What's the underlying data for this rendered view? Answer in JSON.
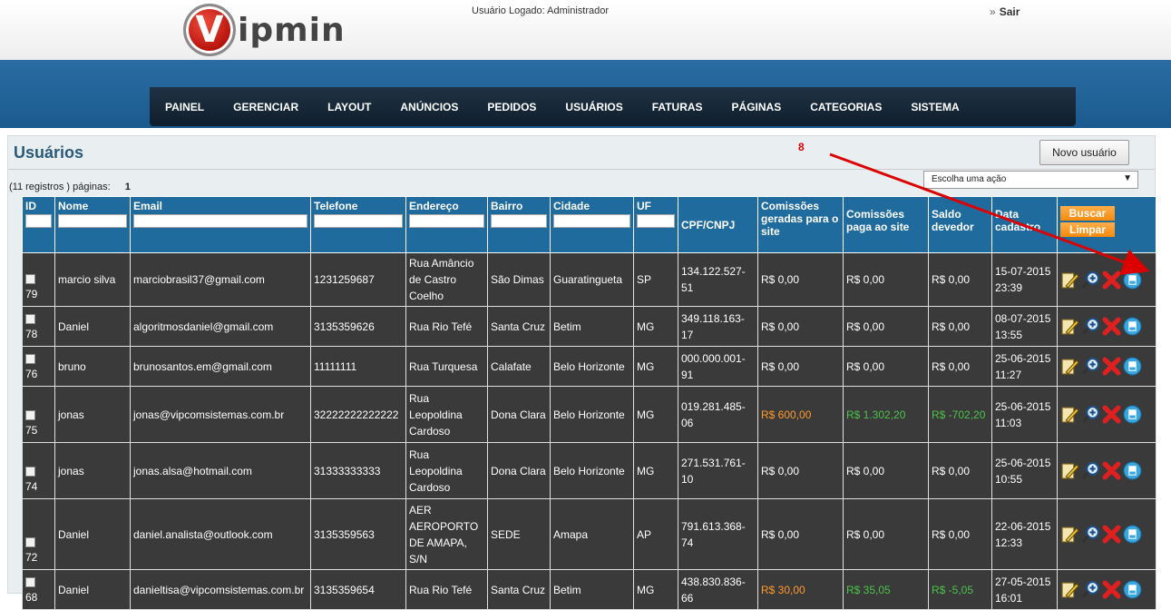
{
  "app": {
    "logo_letter": "V",
    "logo_text": "ipmin",
    "logged_user": "Usuário Logado: Administrador",
    "logout_label": "Sair"
  },
  "nav": [
    "PAINEL",
    "GERENCIAR",
    "LAYOUT",
    "ANÚNCIOS",
    "PEDIDOS",
    "USUÁRIOS",
    "FATURAS",
    "PÁGINAS",
    "CATEGORIAS",
    "SISTEMA"
  ],
  "page": {
    "title": "Usuários",
    "new_button": "Novo usuário",
    "marker": "8",
    "pager_text": "(11 registros ) páginas:",
    "pager_page": "1",
    "action_select": "Escolha uma ação"
  },
  "table": {
    "headers": {
      "id": "ID",
      "nome": "Nome",
      "email": "Email",
      "telefone": "Telefone",
      "endereco": "Endereço",
      "bairro": "Bairro",
      "cidade": "Cidade",
      "uf": "UF",
      "cpf": "CPF/CNPJ",
      "comissoes_geradas": "Comissões geradas para o site",
      "comissoes_paga": "Comissões paga ao site",
      "saldo": "Saldo devedor",
      "data": "Data cadastro"
    },
    "search_button": "Buscar",
    "clear_button": "Limpar",
    "rows": [
      {
        "id": "79",
        "nome": "marcio silva",
        "email": "marciobrasil37@gmail.com",
        "telefone": "1231259687",
        "endereco": "Rua Amâncio de Castro Coelho",
        "bairro": "São Dimas",
        "cidade": "Guaratingueta",
        "uf": "SP",
        "cpf": "134.122.527-51",
        "geradas": "R$ 0,00",
        "paga": "R$ 0,00",
        "saldo": "R$ 0,00",
        "data": "15-07-2015 23:39"
      },
      {
        "id": "78",
        "nome": "Daniel",
        "email": "algoritmosdaniel@gmail.com",
        "telefone": "3135359626",
        "endereco": "Rua Rio Tefé",
        "bairro": "Santa Cruz",
        "cidade": "Betim",
        "uf": "MG",
        "cpf": "349.118.163-17",
        "geradas": "R$ 0,00",
        "paga": "R$ 0,00",
        "saldo": "R$ 0,00",
        "data": "08-07-2015 13:55"
      },
      {
        "id": "76",
        "nome": "bruno",
        "email": "brunosantos.em@gmail.com",
        "telefone": "11111111",
        "endereco": "Rua Turquesa",
        "bairro": "Calafate",
        "cidade": "Belo Horizonte",
        "uf": "MG",
        "cpf": "000.000.001-91",
        "geradas": "R$ 0,00",
        "paga": "R$ 0,00",
        "saldo": "R$ 0,00",
        "data": "25-06-2015 11:27"
      },
      {
        "id": "75",
        "nome": "jonas",
        "email": "jonas@vipcomsistemas.com.br",
        "telefone": "32222222222222",
        "endereco": "Rua Leopoldina Cardoso",
        "bairro": "Dona Clara",
        "cidade": "Belo Horizonte",
        "uf": "MG",
        "cpf": "019.281.485-06",
        "geradas": "R$ 600,00",
        "paga": "R$ 1.302,20",
        "saldo": "R$ -702,20",
        "data": "25-06-2015 11:03"
      },
      {
        "id": "74",
        "nome": "jonas",
        "email": "jonas.alsa@hotmail.com",
        "telefone": "31333333333",
        "endereco": "Rua Leopoldina Cardoso",
        "bairro": "Dona Clara",
        "cidade": "Belo Horizonte",
        "uf": "MG",
        "cpf": "271.531.761-10",
        "geradas": "R$ 0,00",
        "paga": "R$ 0,00",
        "saldo": "R$ 0,00",
        "data": "25-06-2015 10:55"
      },
      {
        "id": "72",
        "nome": "Daniel",
        "email": "daniel.analista@outlook.com",
        "telefone": "3135359563",
        "endereco": "AER AEROPORTO DE AMAPA, S/N",
        "bairro": "SEDE",
        "cidade": "Amapa",
        "uf": "AP",
        "cpf": "791.613.368-74",
        "geradas": "R$ 0,00",
        "paga": "R$ 0,00",
        "saldo": "R$ 0,00",
        "data": "22-06-2015 12:33"
      },
      {
        "id": "68",
        "nome": "Daniel",
        "email": "danieltisa@vipcomsistemas.com.br",
        "telefone": "3135359654",
        "endereco": "Rua Rio Tefé",
        "bairro": "Santa Cruz",
        "cidade": "Betim",
        "uf": "MG",
        "cpf": "438.830.836-66",
        "geradas": "R$ 30,00",
        "paga": "R$ 35,05",
        "saldo": "R$ -5,05",
        "data": "27-05-2015 16:01"
      }
    ]
  },
  "colors": {
    "header_blue": "#1f6b9e",
    "row_dark": "#3a3a3a",
    "orange_value": "#ff9b2b",
    "green_value": "#4cc24c",
    "annotation_red": "#dd0000"
  },
  "icons": [
    "edit-icon",
    "zoom-in-icon",
    "delete-icon",
    "save-icon"
  ]
}
